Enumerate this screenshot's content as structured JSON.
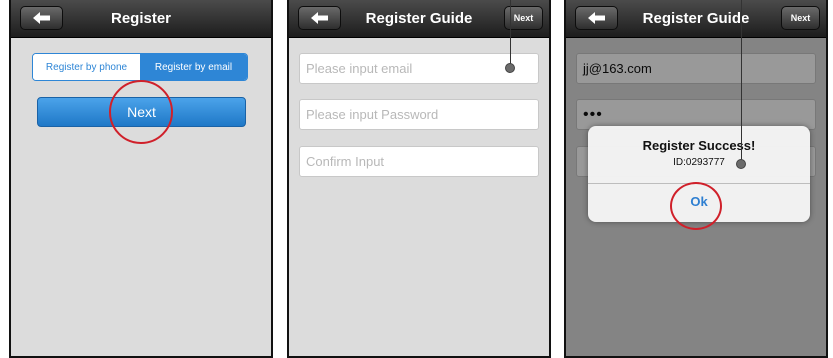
{
  "screen1": {
    "title": "Register",
    "back_icon": "back-arrow-icon",
    "segments": [
      "Register by phone",
      "Register by email"
    ],
    "selected_segment": "Register by email",
    "next_label": "Next"
  },
  "screen2": {
    "title": "Register Guide",
    "back_icon": "back-arrow-icon",
    "next_label": "Next",
    "fields": [
      {
        "placeholder": "Please input email",
        "value": ""
      },
      {
        "placeholder": "Please input Password",
        "value": ""
      },
      {
        "placeholder": "Confirm Input",
        "value": ""
      }
    ]
  },
  "screen3": {
    "title": "Register Guide",
    "back_icon": "back-arrow-icon",
    "next_label": "Next",
    "email_value": "jj@163.com",
    "password_value": "•••",
    "dialog": {
      "title": "Register Success!",
      "message": "ID:0293777",
      "ok_label": "Ok"
    }
  },
  "colors": {
    "accent": "#2e86d6",
    "highlight_circle": "#d0202a",
    "navbar": "#2a2a2a",
    "background": "#dcdcdc"
  }
}
